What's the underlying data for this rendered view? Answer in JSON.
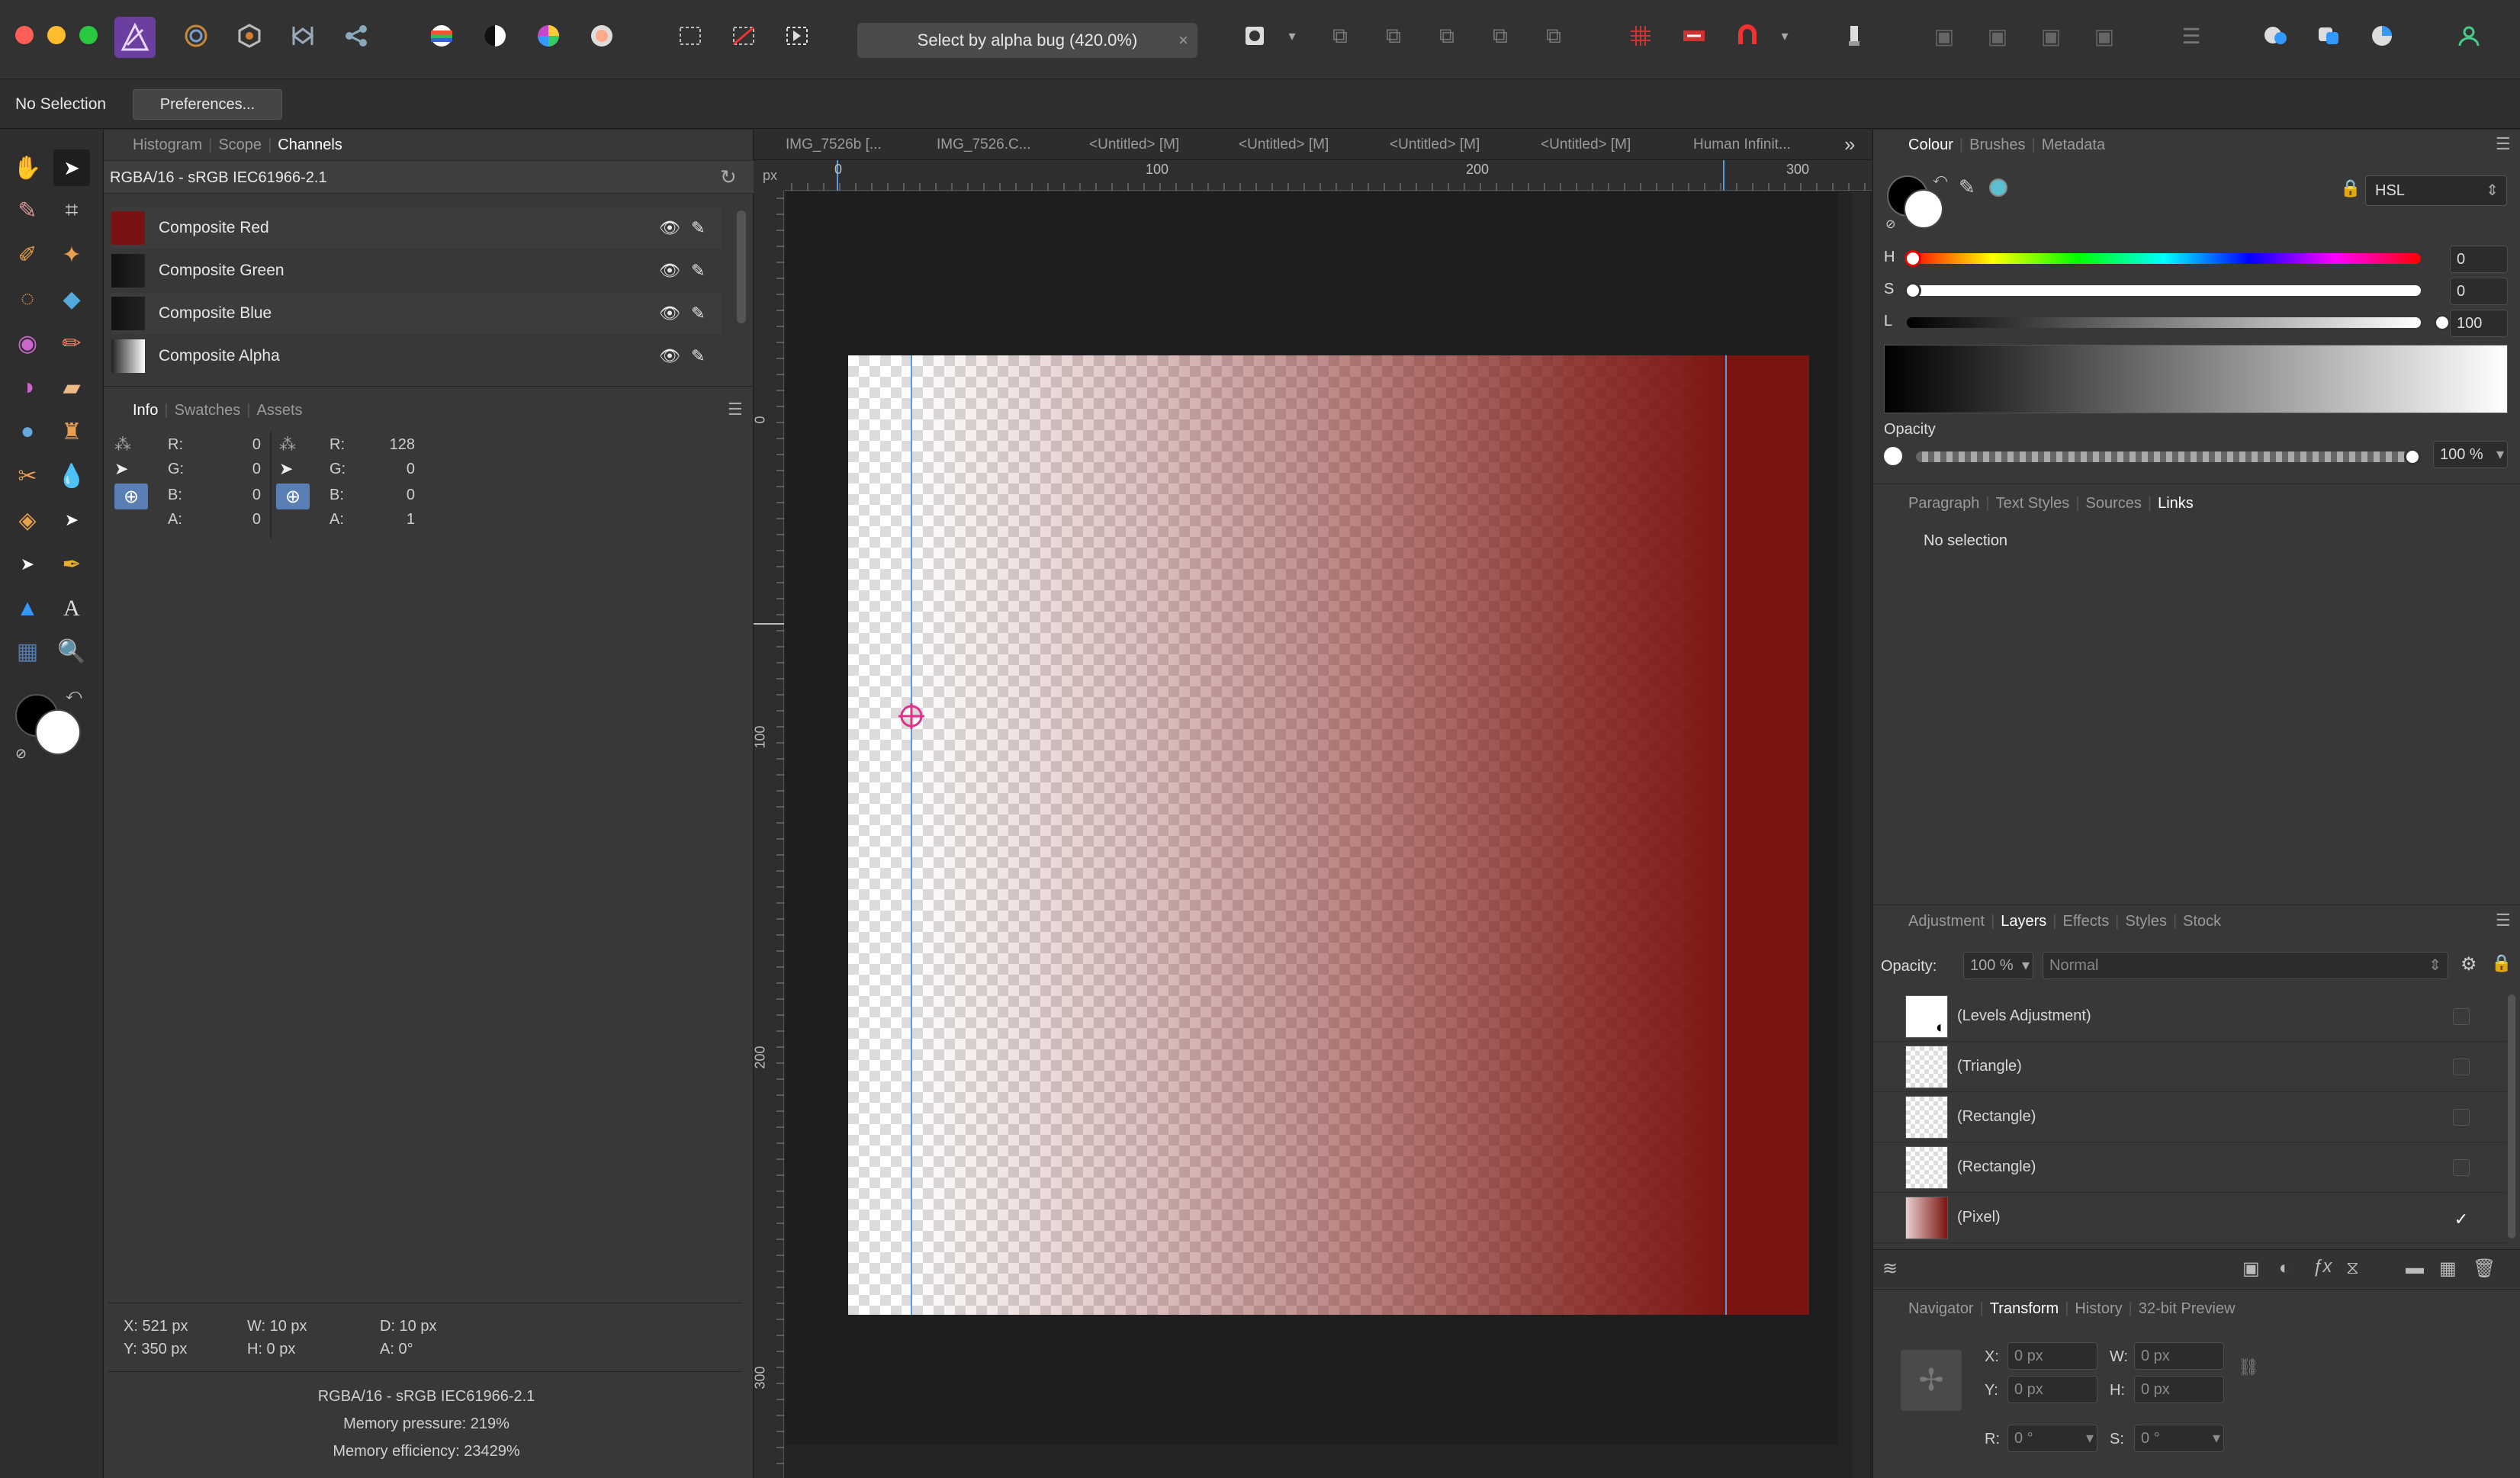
{
  "app": {
    "document_title": "Select by alpha bug (420.0%)",
    "close_glyph": "×"
  },
  "context": {
    "selection": "No Selection",
    "preferences": "Preferences..."
  },
  "left_top_tabs": [
    "Histogram",
    "Scope",
    "Channels"
  ],
  "channels": {
    "profile": "RGBA/16 - sRGB IEC61966-2.1",
    "items": [
      {
        "label": "Composite Red",
        "swatch": "#7a1212"
      },
      {
        "label": "Composite Green",
        "swatch": "#111111"
      },
      {
        "label": "Composite Blue",
        "swatch": "#111111"
      },
      {
        "label": "Composite Alpha",
        "swatch": "#d8d8d8"
      }
    ]
  },
  "left_mid_tabs": [
    "Info",
    "Swatches",
    "Assets"
  ],
  "info": {
    "left": {
      "R": "0",
      "G": "0",
      "B": "0",
      "A": "0"
    },
    "right": {
      "R": "128",
      "G": "0",
      "B": "0",
      "A": "1"
    },
    "labels": {
      "R": "R:",
      "G": "G:",
      "B": "B:",
      "A": "A:"
    },
    "transform": {
      "x": "X: 521 px",
      "y": "Y: 350 px",
      "w": "W: 10 px",
      "h": "H: 0 px",
      "d": "D: 10 px",
      "a": "A: 0°"
    },
    "footer": [
      "RGBA/16 - sRGB IEC61966-2.1",
      "Memory pressure: 219%",
      "Memory efficiency: 23429%"
    ]
  },
  "doc_tabs": [
    "IMG_7526b [...",
    "IMG_7526.C...",
    "<Untitled> [M]",
    "<Untitled> [M]",
    "<Untitled> [M]",
    "<Untitled> [M]",
    "Human Infinit..."
  ],
  "ruler": {
    "unit": "px",
    "top": [
      "0",
      "100",
      "200",
      "300"
    ],
    "left": [
      "0",
      "100",
      "200",
      "300"
    ]
  },
  "colour": {
    "tabs": [
      "Colour",
      "Brushes",
      "Metadata"
    ],
    "mode": "HSL",
    "h_label": "H",
    "s_label": "S",
    "l_label": "L",
    "h": "0",
    "s": "0",
    "l": "100",
    "opacity_label": "Opacity",
    "opacity": "100 %"
  },
  "text_panel": {
    "tabs": [
      "Paragraph",
      "Text Styles",
      "Sources",
      "Links"
    ],
    "message": "No selection"
  },
  "layers_panel": {
    "tabs": [
      "Adjustment",
      "Layers",
      "Effects",
      "Styles",
      "Stock"
    ],
    "opacity_label": "Opacity:",
    "opacity": "100 %",
    "blend": "Normal",
    "layers": [
      "(Levels Adjustment)",
      "(Triangle)",
      "(Rectangle)",
      "(Rectangle)",
      "(Pixel)"
    ]
  },
  "transform_panel": {
    "tabs": [
      "Navigator",
      "Transform",
      "History",
      "32-bit Preview"
    ],
    "x_label": "X:",
    "y_label": "Y:",
    "w_label": "W:",
    "h_label": "H:",
    "r_label": "R:",
    "s_label": "S:",
    "x": "0 px",
    "y": "0 px",
    "w": "0 px",
    "h": "0 px",
    "r": "0 °",
    "s": "0 °"
  },
  "colors": {
    "accent": "#5a7fb5",
    "doc_red": "#7b1410"
  }
}
